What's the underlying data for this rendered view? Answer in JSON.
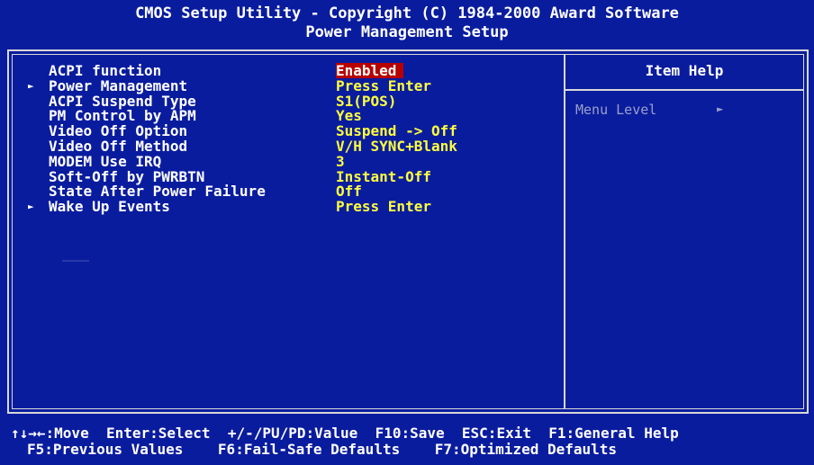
{
  "header": {
    "title_line1": "CMOS Setup Utility - Copyright (C) 1984-2000 Award Software",
    "title_line2": "Power Management Setup"
  },
  "settings": [
    {
      "label": "ACPI function",
      "value": "Enabled",
      "submenu": false,
      "selected": true
    },
    {
      "label": "Power Management",
      "value": "Press Enter",
      "submenu": true,
      "selected": false
    },
    {
      "label": "ACPI Suspend Type",
      "value": "S1(POS)",
      "submenu": false,
      "selected": false
    },
    {
      "label": "PM Control by APM",
      "value": "Yes",
      "submenu": false,
      "selected": false
    },
    {
      "label": "Video Off Option",
      "value": "Suspend -> Off",
      "submenu": false,
      "selected": false
    },
    {
      "label": "Video Off Method",
      "value": "V/H SYNC+Blank",
      "submenu": false,
      "selected": false
    },
    {
      "label": "MODEM Use IRQ",
      "value": "3",
      "submenu": false,
      "selected": false
    },
    {
      "label": "Soft-Off by PWRBTN",
      "value": "Instant-Off",
      "submenu": false,
      "selected": false
    },
    {
      "label": "State After Power Failure",
      "value": "Off",
      "submenu": false,
      "selected": false
    },
    {
      "label": "Wake Up Events",
      "value": "Press Enter",
      "submenu": true,
      "selected": false
    }
  ],
  "help": {
    "title": "Item Help",
    "menu_level_label": "Menu Level",
    "menu_level_arrow": "►"
  },
  "footer": {
    "line1": "↑↓→←:Move  Enter:Select  +/-/PU/PD:Value  F10:Save  ESC:Exit  F1:General Help",
    "line2": "F5:Previous Values    F6:Fail-Safe Defaults    F7:Optimized Defaults"
  },
  "colors": {
    "background": "#0a1c9e",
    "value_text": "#ffff3c",
    "highlight": "#b80000",
    "border": "#d8d8d8"
  }
}
